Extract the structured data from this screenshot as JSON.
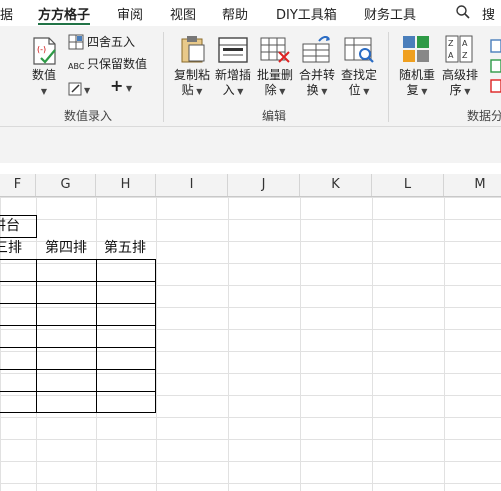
{
  "menu": {
    "items": [
      "据",
      "方方格子",
      "审阅",
      "视图",
      "帮助",
      "DIY工具箱",
      "财务工具",
      "搜"
    ],
    "active": "方方格子"
  },
  "ribbon": {
    "groups": {
      "numeric_entry": {
        "label": "数值录入",
        "numeric_button": "数值",
        "round_button": "四舍五入",
        "keep_values_button": "只保留数值",
        "abc_badge": "ABC"
      },
      "edit": {
        "label": "编辑",
        "copy_paste": [
          "复制粘",
          "贴"
        ],
        "insert_new": [
          "新增插",
          "入"
        ],
        "batch_delete": [
          "批量删",
          "除"
        ],
        "merge_convert": [
          "合并转",
          "换"
        ],
        "find_locate": [
          "查找定",
          "位"
        ]
      },
      "data_analysis": {
        "label": "数据分",
        "random_reorder": [
          "随机重",
          "复"
        ],
        "advanced_sort": [
          "高级排",
          "序"
        ]
      }
    }
  },
  "sheet": {
    "columns": [
      "F",
      "G",
      "H",
      "I",
      "J",
      "K",
      "L",
      "M"
    ],
    "cells": {
      "f9": "讲台",
      "f10": "三排",
      "g10": "第四排",
      "h10": "第五排"
    }
  },
  "colors": {
    "accent": "#217346",
    "ribbon_bg": "#f3f3f3",
    "grid_line": "#e1e1e1"
  }
}
